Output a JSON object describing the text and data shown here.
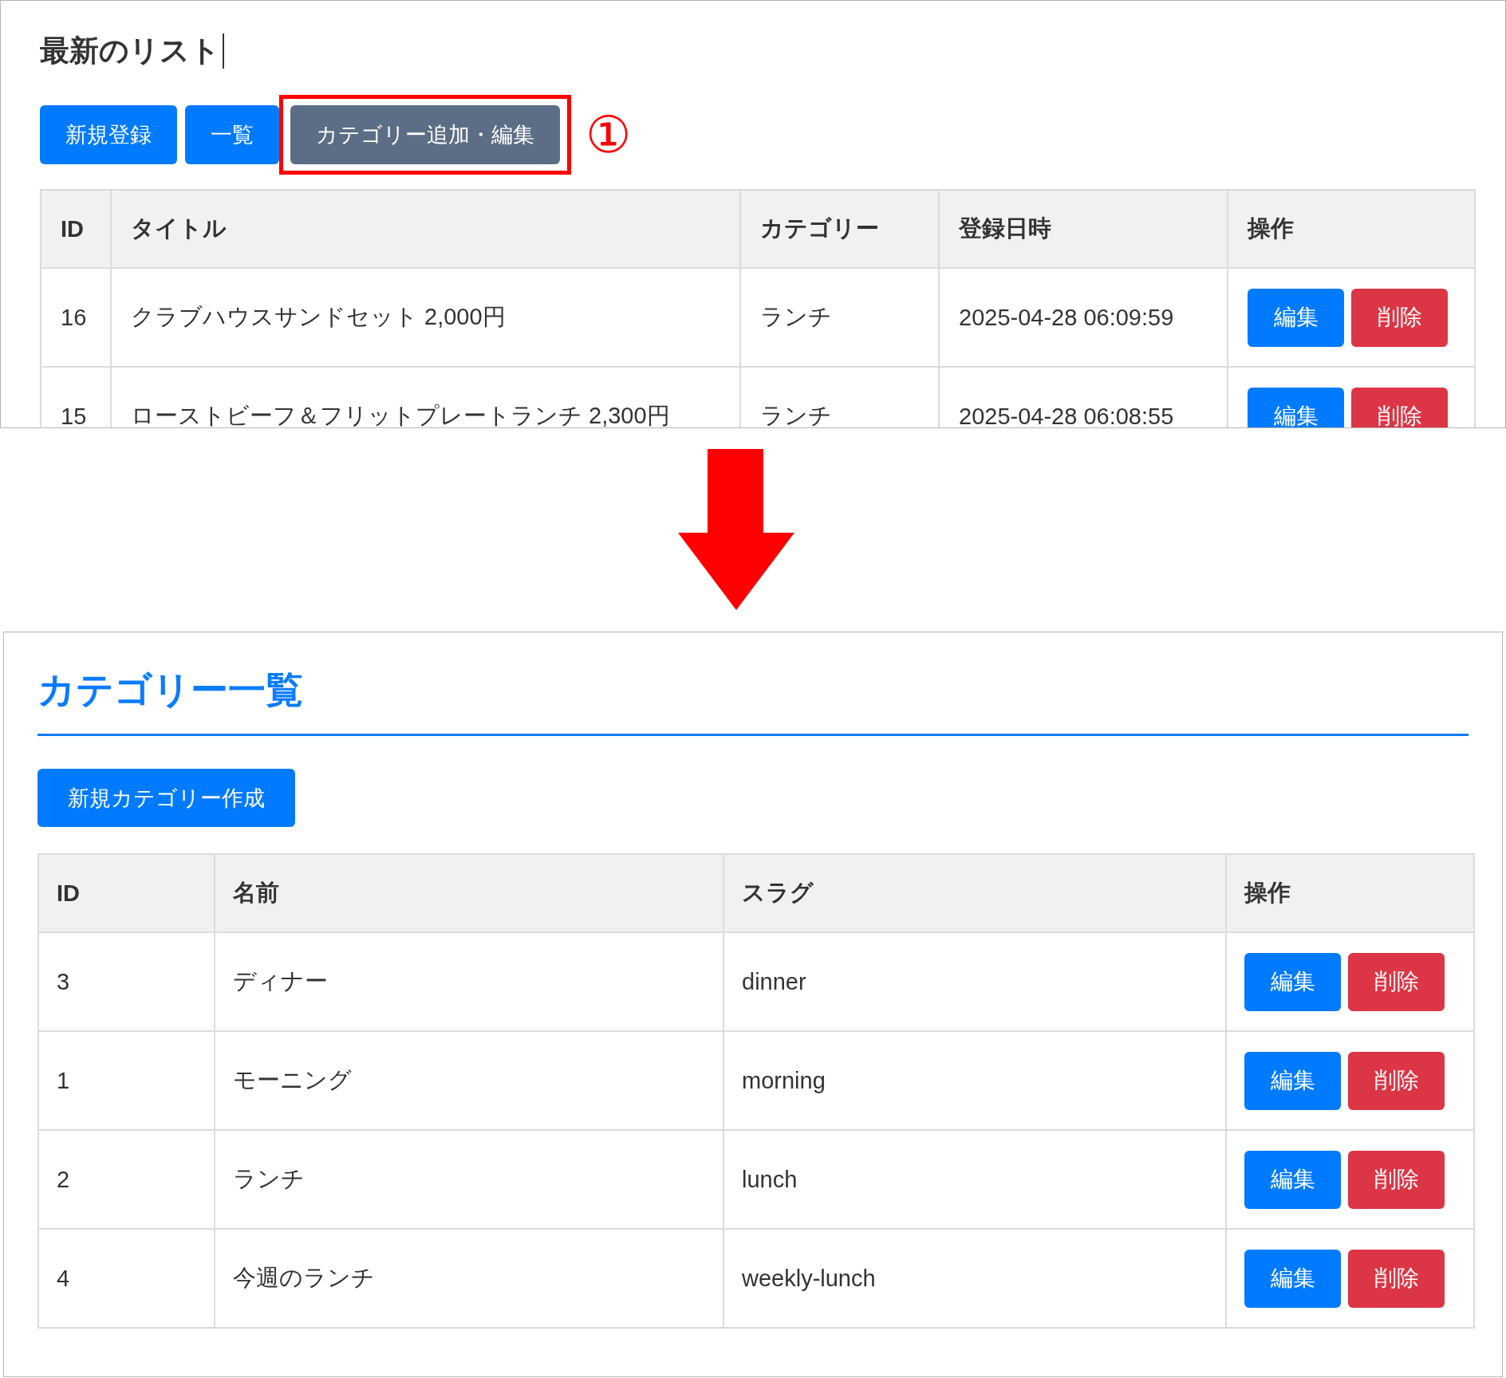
{
  "top_screen": {
    "title": "最新のリスト",
    "text_cursor": true,
    "buttons": [
      {
        "label": "新規登録",
        "kind": "primary",
        "highlighted": false
      },
      {
        "label": "一覧",
        "kind": "primary",
        "highlighted": false
      },
      {
        "label": "カテゴリー追加・編集",
        "kind": "secondary",
        "highlighted": true
      }
    ],
    "callout": "①",
    "table": {
      "columns": [
        "ID",
        "タイトル",
        "カテゴリー",
        "登録日時",
        "操作"
      ],
      "rows": [
        {
          "cells": [
            "16",
            "クラブハウスサンドセット 2,000円",
            "ランチ",
            "2025-04-28 06:09:59"
          ],
          "actions": [
            {
              "label": "編集",
              "kind": "edit"
            },
            {
              "label": "削除",
              "kind": "delete"
            }
          ]
        },
        {
          "cells": [
            "15",
            "ローストビーフ＆フリットプレートランチ 2,300円",
            "ランチ",
            "2025-04-28 06:08:55"
          ],
          "actions": [
            {
              "label": "編集",
              "kind": "edit"
            },
            {
              "label": "削除",
              "kind": "delete"
            }
          ]
        }
      ]
    }
  },
  "bottom_screen": {
    "title": "カテゴリー一覧",
    "button": {
      "label": "新規カテゴリー作成",
      "kind": "primary"
    },
    "table": {
      "columns": [
        "ID",
        "名前",
        "スラグ",
        "操作"
      ],
      "rows": [
        {
          "cells": [
            "3",
            "ディナー",
            "dinner"
          ],
          "actions": [
            {
              "label": "編集",
              "kind": "edit"
            },
            {
              "label": "削除",
              "kind": "delete"
            }
          ]
        },
        {
          "cells": [
            "1",
            "モーニング",
            "morning"
          ],
          "actions": [
            {
              "label": "編集",
              "kind": "edit"
            },
            {
              "label": "削除",
              "kind": "delete"
            }
          ]
        },
        {
          "cells": [
            "2",
            "ランチ",
            "lunch"
          ],
          "actions": [
            {
              "label": "編集",
              "kind": "edit"
            },
            {
              "label": "削除",
              "kind": "delete"
            }
          ]
        },
        {
          "cells": [
            "4",
            "今週のランチ",
            "weekly-lunch"
          ],
          "actions": [
            {
              "label": "編集",
              "kind": "edit"
            },
            {
              "label": "削除",
              "kind": "delete"
            }
          ]
        }
      ]
    }
  }
}
